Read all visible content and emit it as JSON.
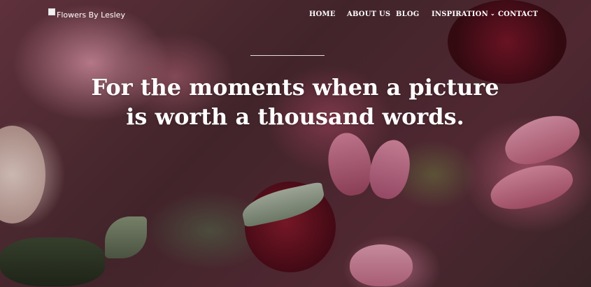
{
  "brand": {
    "logo_text": "Flowers By Lesley"
  },
  "nav": {
    "items": [
      {
        "label": "HOME"
      },
      {
        "label": "ABOUT US"
      },
      {
        "label": "BLOG"
      },
      {
        "label": "INSPIRATION",
        "icon": "chevron-down-icon"
      },
      {
        "label": "CONTACT"
      }
    ]
  },
  "hero": {
    "headline_line1": "For the moments when a picture",
    "headline_line2": "is worth a thousand words."
  },
  "colors": {
    "text": "#ffffff",
    "accent_wine": "#6e1423",
    "accent_pink": "#d98aa0"
  }
}
